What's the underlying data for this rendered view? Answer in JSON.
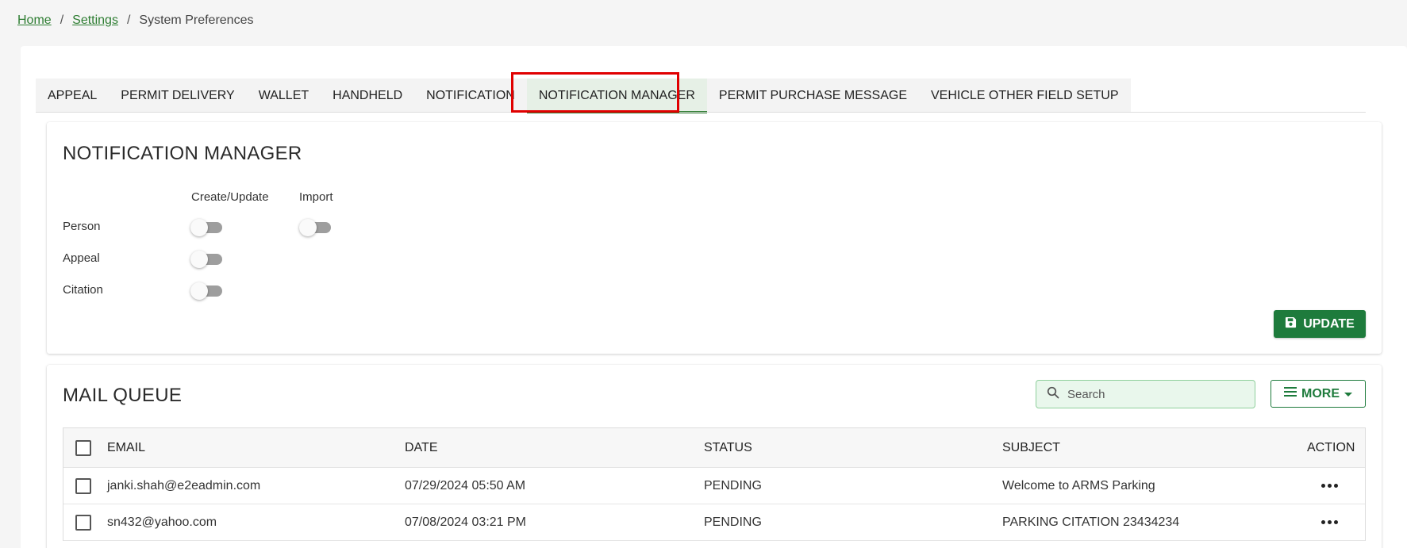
{
  "breadcrumb": {
    "home": "Home",
    "settings": "Settings",
    "current": "System Preferences",
    "sep": "/"
  },
  "tabs": [
    {
      "label": "APPEAL"
    },
    {
      "label": "PERMIT DELIVERY"
    },
    {
      "label": "WALLET"
    },
    {
      "label": "HANDHELD"
    },
    {
      "label": "NOTIFICATION"
    },
    {
      "label": "NOTIFICATION MANAGER"
    },
    {
      "label": "PERMIT PURCHASE MESSAGE"
    },
    {
      "label": "VEHICLE OTHER FIELD SETUP"
    }
  ],
  "active_tab": "NOTIFICATION MANAGER",
  "notification_manager": {
    "title": "NOTIFICATION MANAGER",
    "columns": {
      "create_update": "Create/Update",
      "import": "Import"
    },
    "rows": {
      "person": "Person",
      "appeal": "Appeal",
      "citation": "Citation"
    },
    "toggles": {
      "person_create_update": false,
      "person_import": false,
      "appeal_create_update": false,
      "citation_create_update": false
    },
    "update_label": "UPDATE"
  },
  "mail_queue": {
    "title": "MAIL QUEUE",
    "search_placeholder": "Search",
    "more_label": "MORE",
    "headers": {
      "email": "EMAIL",
      "date": "DATE",
      "status": "STATUS",
      "subject": "SUBJECT",
      "action": "ACTION"
    },
    "rows": [
      {
        "email": "janki.shah@e2eadmin.com",
        "date": "07/29/2024 05:50 AM",
        "status": "PENDING",
        "subject": "Welcome to ARMS Parking"
      },
      {
        "email": "sn432@yahoo.com",
        "date": "07/08/2024 03:21 PM",
        "status": "PENDING",
        "subject": "PARKING CITATION 23434234"
      }
    ]
  },
  "colors": {
    "accent": "#1e7b3c",
    "highlight": "#e00000",
    "toggle_off": "#9e9e9e"
  },
  "icons": {
    "update": "save-icon",
    "search": "search-icon",
    "more": "menu-icon",
    "more_caret": "caret-down-icon",
    "row_action": "more-horizontal-icon"
  }
}
